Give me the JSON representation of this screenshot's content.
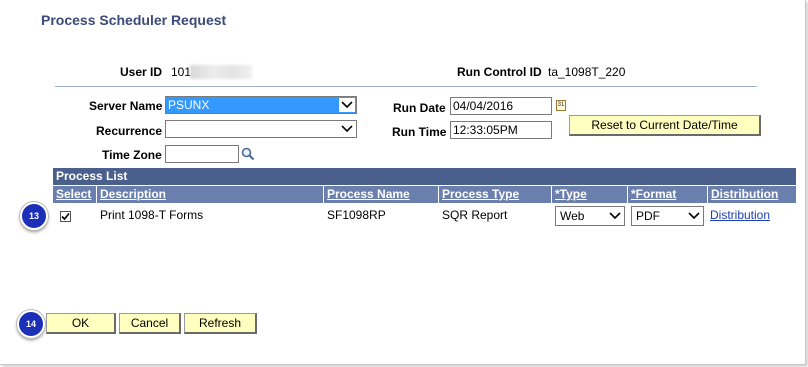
{
  "page": {
    "title": "Process Scheduler Request"
  },
  "header": {
    "user_id_label": "User ID",
    "user_id_value": "101",
    "run_control_label": "Run Control ID",
    "run_control_value": "ta_1098T_220"
  },
  "form": {
    "server_name_label": "Server Name",
    "server_name_value": "PSUNX",
    "recurrence_label": "Recurrence",
    "recurrence_value": "",
    "time_zone_label": "Time Zone",
    "time_zone_value": "",
    "run_date_label": "Run Date",
    "run_date_value": "04/04/2016",
    "run_time_label": "Run Time",
    "run_time_value": "12:33:05PM",
    "reset_button": "Reset to Current Date/Time"
  },
  "process_list": {
    "title": "Process List",
    "columns": [
      "Select",
      "Description",
      "Process Name",
      "Process Type",
      "*Type",
      "*Format",
      "Distribution"
    ],
    "rows": [
      {
        "selected": true,
        "description": "Print 1098-T Forms",
        "process_name": "SF1098RP",
        "process_type": "SQR Report",
        "type": "Web",
        "format": "PDF",
        "distribution": "Distribution"
      }
    ]
  },
  "buttons": {
    "ok": "OK",
    "cancel": "Cancel",
    "refresh": "Refresh"
  },
  "annotations": {
    "step_13": "13",
    "step_14": "14"
  },
  "icons": {
    "lookup": "magnifier-icon",
    "calendar": "calendar-icon",
    "dropdown": "chevron-down-icon",
    "check": "checkmark-icon"
  },
  "colors": {
    "title": "#3b4a7a",
    "grid_header": "#4a5f8c",
    "column_header": "#6a7fae",
    "highlight": "#3399ff",
    "button_bg": "#ffffc0",
    "badge": "#1c2fb8",
    "link": "#1a3fb8"
  }
}
